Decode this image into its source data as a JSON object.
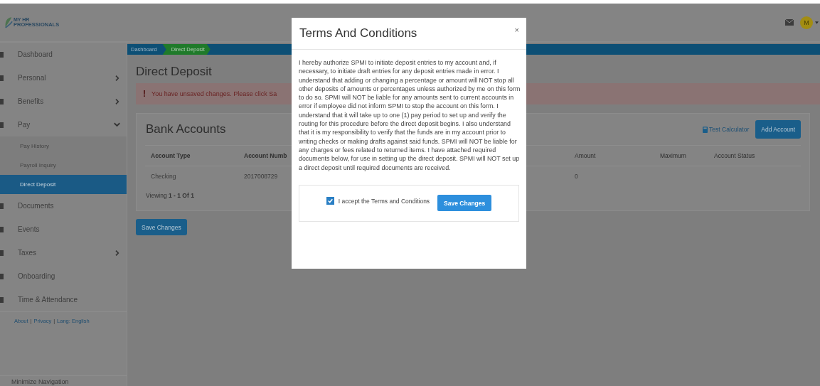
{
  "header": {
    "logo_small": "MY HR",
    "logo_main": "PROFESSIONALS",
    "avatar_initial": "M"
  },
  "sidebar": {
    "items": [
      {
        "label": "Dashboard"
      },
      {
        "label": "Personal",
        "expanded": false
      },
      {
        "label": "Benefits",
        "expanded": false
      },
      {
        "label": "Pay",
        "expanded": true,
        "children": [
          {
            "label": "Pay History",
            "selected": false
          },
          {
            "label": "Payroll Inquiry",
            "selected": false
          },
          {
            "label": "Direct Deposit",
            "selected": true
          }
        ]
      },
      {
        "label": "Documents"
      },
      {
        "label": "Events"
      },
      {
        "label": "Taxes",
        "expanded": false
      },
      {
        "label": "Onboarding"
      },
      {
        "label": "Time & Attendance"
      }
    ],
    "footer_links": [
      "About",
      "Privacy",
      "Lang: English"
    ],
    "footer_separator": "|",
    "minimize": "Minimize Navigation"
  },
  "breadcrumb": [
    {
      "label": "Dashboard",
      "selected": false
    },
    {
      "label": "Direct Deposit",
      "selected": true
    }
  ],
  "page_title": "Direct Deposit",
  "alert": {
    "icon": "!",
    "text": "You have unsaved changes. Please click Sa"
  },
  "bank_accounts": {
    "title": "Bank Accounts",
    "test_calculator": "Test Calculator",
    "add_account": "Add Account",
    "columns": [
      "Account Type",
      "Account Numb",
      "Amount",
      "Maximum",
      "Account Status"
    ],
    "rows": [
      {
        "account_type": "Checking",
        "account_number": "2017008729",
        "amount": "0"
      }
    ],
    "viewing": "Viewing **1 - 1 Of 1**"
  },
  "save_button": "Save Changes",
  "modal": {
    "title": "Terms And Conditions",
    "close": "×",
    "body": "I hereby authorize SPMI to initiate deposit entries to my account and, if necessary, to initiate draft entries for any deposit entries made in error. I understand that adding or changing a percentage or amount will NOT stop all other deposits of amounts or percentages unless authorized by me on this form to do so. SPMI will NOT be liable for any amounts sent to current accounts in error if employee did not inform SPMI to stop the account on this form. I understand that it will take up to one (1) pay period to set up and verify the routing for this procedure before the direct deposit begins. I also understand that it is my responsibility to verify that the funds are in my account prior to writing checks or making drafts against said funds. SPMI will NOT be liable for any charges or fees related to returned items. I have attached required documents below, for use in setting up the direct deposit. SPMI will NOT set up a direct deposit until required documents are received.",
    "accept": {
      "label": "I accept the Terms and Conditions",
      "checked": true
    },
    "save": "Save Changes"
  }
}
